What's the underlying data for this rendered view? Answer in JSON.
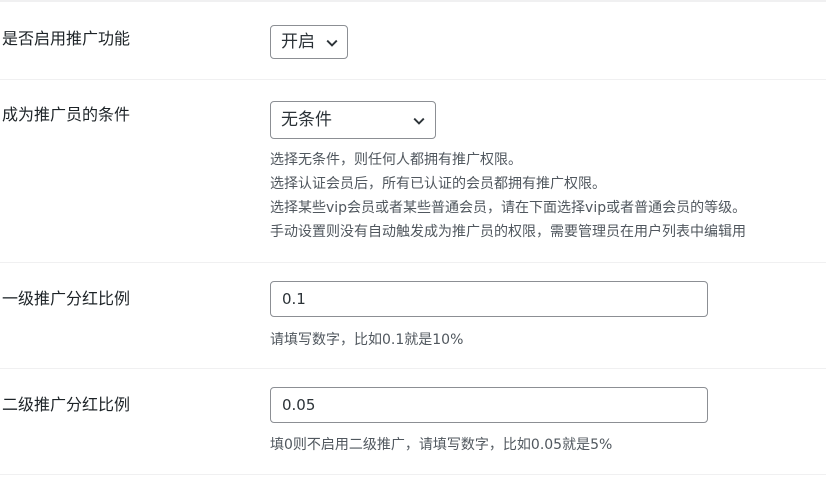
{
  "settings": {
    "enable_promotion": {
      "label": "是否启用推广功能",
      "value": "开启"
    },
    "promoter_condition": {
      "label": "成为推广员的条件",
      "value": "无条件",
      "descriptions": [
        "选择无条件，则任何人都拥有推广权限。",
        "选择认证会员后，所有已认证的会员都拥有推广权限。",
        "选择某些vip会员或者某些普通会员，请在下面选择vip或者普通会员的等级。",
        "手动设置则没有自动触发成为推广员的权限，需要管理员在用户列表中编辑用"
      ]
    },
    "level1_ratio": {
      "label": "一级推广分红比例",
      "value": "0.1",
      "description": "请填写数字，比如0.1就是10%"
    },
    "level2_ratio": {
      "label": "二级推广分红比例",
      "value": "0.05",
      "description": "填0则不启用二级推广，请填写数字，比如0.05就是5%"
    }
  }
}
